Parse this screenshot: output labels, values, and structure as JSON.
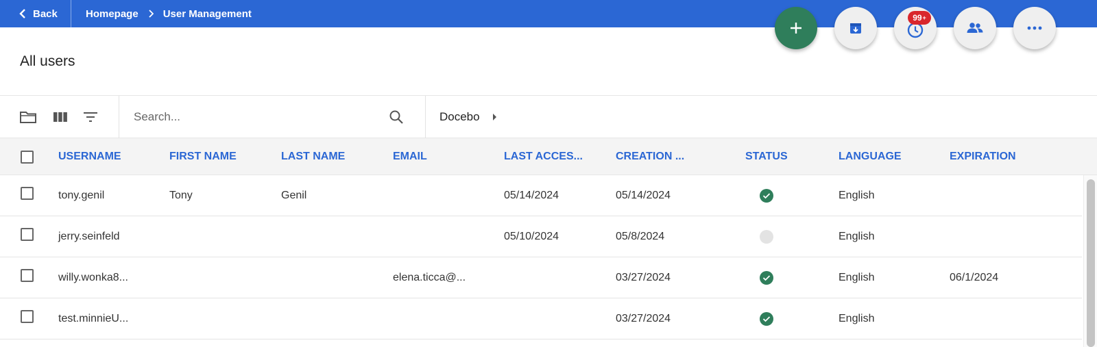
{
  "header": {
    "back_label": "Back",
    "breadcrumb": [
      "Homepage",
      "User Management"
    ]
  },
  "actions": {
    "notifications_badge": "99",
    "notifications_badge_suffix": "+"
  },
  "page": {
    "title": "All users"
  },
  "toolbar": {
    "search_placeholder": "Search...",
    "branch": "Docebo"
  },
  "table": {
    "columns": [
      "USERNAME",
      "FIRST NAME",
      "LAST NAME",
      "EMAIL",
      "LAST ACCES...",
      "CREATION ...",
      "STATUS",
      "LANGUAGE",
      "EXPIRATION"
    ],
    "rows": [
      {
        "username": "tony.genil",
        "first_name": "Tony",
        "last_name": "Genil",
        "email": "",
        "last_access": "05/14/2024",
        "creation": "05/14/2024",
        "status": "active",
        "language": "English",
        "expiration": ""
      },
      {
        "username": "jerry.seinfeld",
        "first_name": "",
        "last_name": "",
        "email": "",
        "last_access": "05/10/2024",
        "creation": "05/8/2024",
        "status": "inactive",
        "language": "English",
        "expiration": ""
      },
      {
        "username": "willy.wonka8...",
        "first_name": "",
        "last_name": "",
        "email": "elena.ticca@...",
        "last_access": "",
        "creation": "03/27/2024",
        "status": "active",
        "language": "English",
        "expiration": "06/1/2024"
      },
      {
        "username": "test.minnieU...",
        "first_name": "",
        "last_name": "",
        "email": "",
        "last_access": "",
        "creation": "03/27/2024",
        "status": "active",
        "language": "English",
        "expiration": ""
      }
    ]
  },
  "colors": {
    "header_blue": "#2b67d4",
    "primary_green": "#2f7e5b",
    "badge_red": "#d9262c",
    "column_link": "#2b67d4"
  }
}
